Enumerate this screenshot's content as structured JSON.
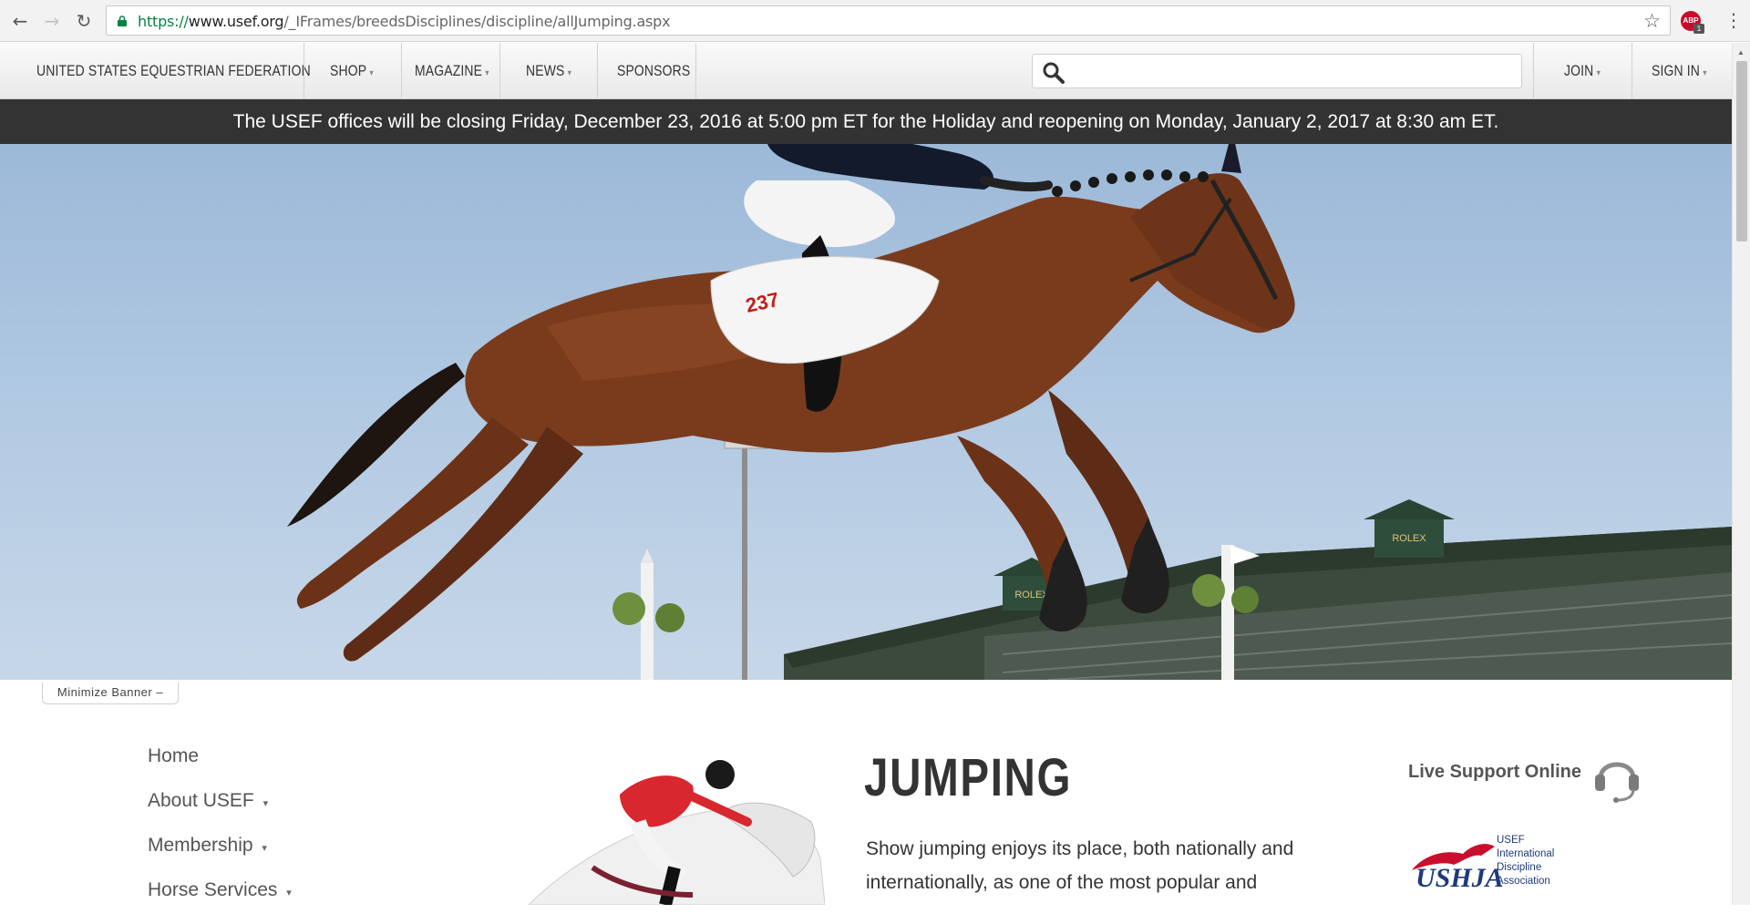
{
  "browser": {
    "url_secure": "https://",
    "url_host": "www.usef.org",
    "url_path": "/_IFrames/breedsDisciplines/discipline/allJumping.aspx",
    "adblock_label": "ABP",
    "adblock_count": "1"
  },
  "nav": {
    "brand": "UNITED STATES EQUESTRIAN FEDERATION",
    "shop": "SHOP",
    "magazine": "MAGAZINE",
    "news": "NEWS",
    "sponsors": "SPONSORS",
    "join": "JOIN",
    "sign_in": "SIGN IN",
    "search_placeholder": ""
  },
  "announcement": "The USEF offices will be closing Friday, December 23, 2016 at 5:00 pm ET for the Holiday and reopening on Monday, January 2, 2017 at 8:30 am ET.",
  "hero": {
    "saddle_number": "237",
    "stadium_sign_1": "ROLEX",
    "stadium_sign_2": "ROLEX",
    "minimize_label": "Minimize Banner –"
  },
  "sidebar": {
    "items": [
      {
        "label": "Home",
        "has_caret": false
      },
      {
        "label": "About USEF",
        "has_caret": true
      },
      {
        "label": "Membership",
        "has_caret": true
      },
      {
        "label": "Horse Services",
        "has_caret": true
      }
    ]
  },
  "main": {
    "title": "JUMPING",
    "intro": "Show jumping enjoys its place, both nationally and internationally, as one of the most popular and"
  },
  "right_rail": {
    "live_support": "Live Support Online",
    "ushja_line1": "USEF",
    "ushja_line2": "International",
    "ushja_line3": "Discipline",
    "ushja_line4": "Association",
    "ushja_logo_text": "USHJA"
  },
  "colors": {
    "announcement_bg": "#333333",
    "secure_green": "#0b8043",
    "usef_navy": "#1f3a7a",
    "ushja_red": "#c8102e"
  }
}
